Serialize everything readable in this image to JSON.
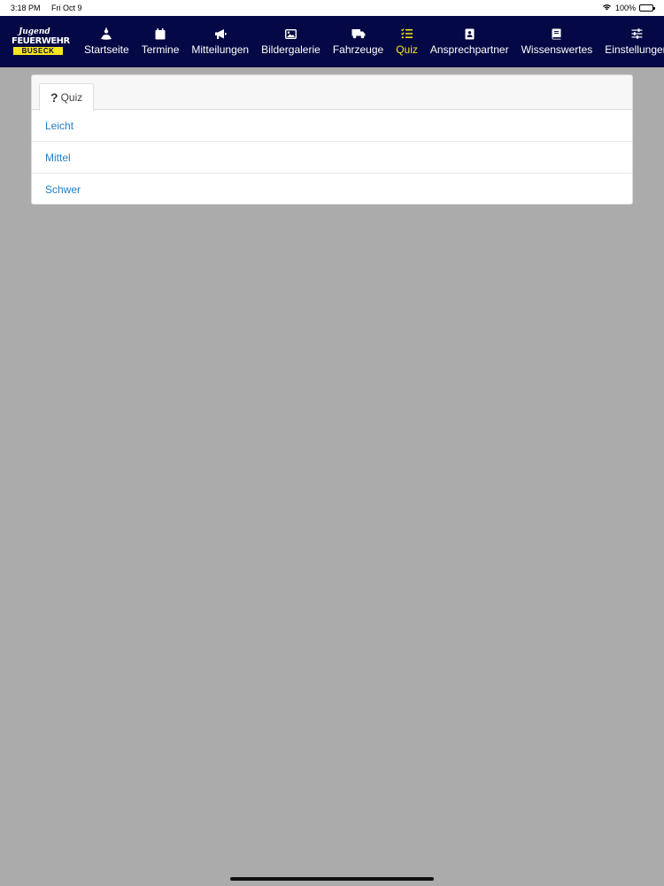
{
  "status_bar": {
    "time": "3:18 PM",
    "date": "Fri Oct 9",
    "battery": "100%"
  },
  "logo": {
    "line1": "Jugend",
    "line2": "FEUERWEHR",
    "line3": "BUSECK"
  },
  "nav": {
    "items": [
      {
        "label": "Startseite",
        "icon": "firefighter-icon"
      },
      {
        "label": "Termine",
        "icon": "calendar-icon"
      },
      {
        "label": "Mitteilungen",
        "icon": "megaphone-icon"
      },
      {
        "label": "Bildergalerie",
        "icon": "image-icon"
      },
      {
        "label": "Fahrzeuge",
        "icon": "truck-icon"
      },
      {
        "label": "Quiz",
        "icon": "checklist-icon",
        "active": true
      },
      {
        "label": "Ansprechpartner",
        "icon": "contact-card-icon"
      },
      {
        "label": "Wissenswertes",
        "icon": "book-icon"
      },
      {
        "label": "Einstellungen",
        "icon": "sliders-icon"
      }
    ]
  },
  "card": {
    "tab_label": "Quiz",
    "tab_icon": "question-icon",
    "items": [
      "Leicht",
      "Mittel",
      "Schwer"
    ]
  },
  "colors": {
    "navbar_bg": "#040844",
    "active_nav": "#f5e61b",
    "link": "#1f7fc4",
    "page_bg": "#ababab"
  }
}
